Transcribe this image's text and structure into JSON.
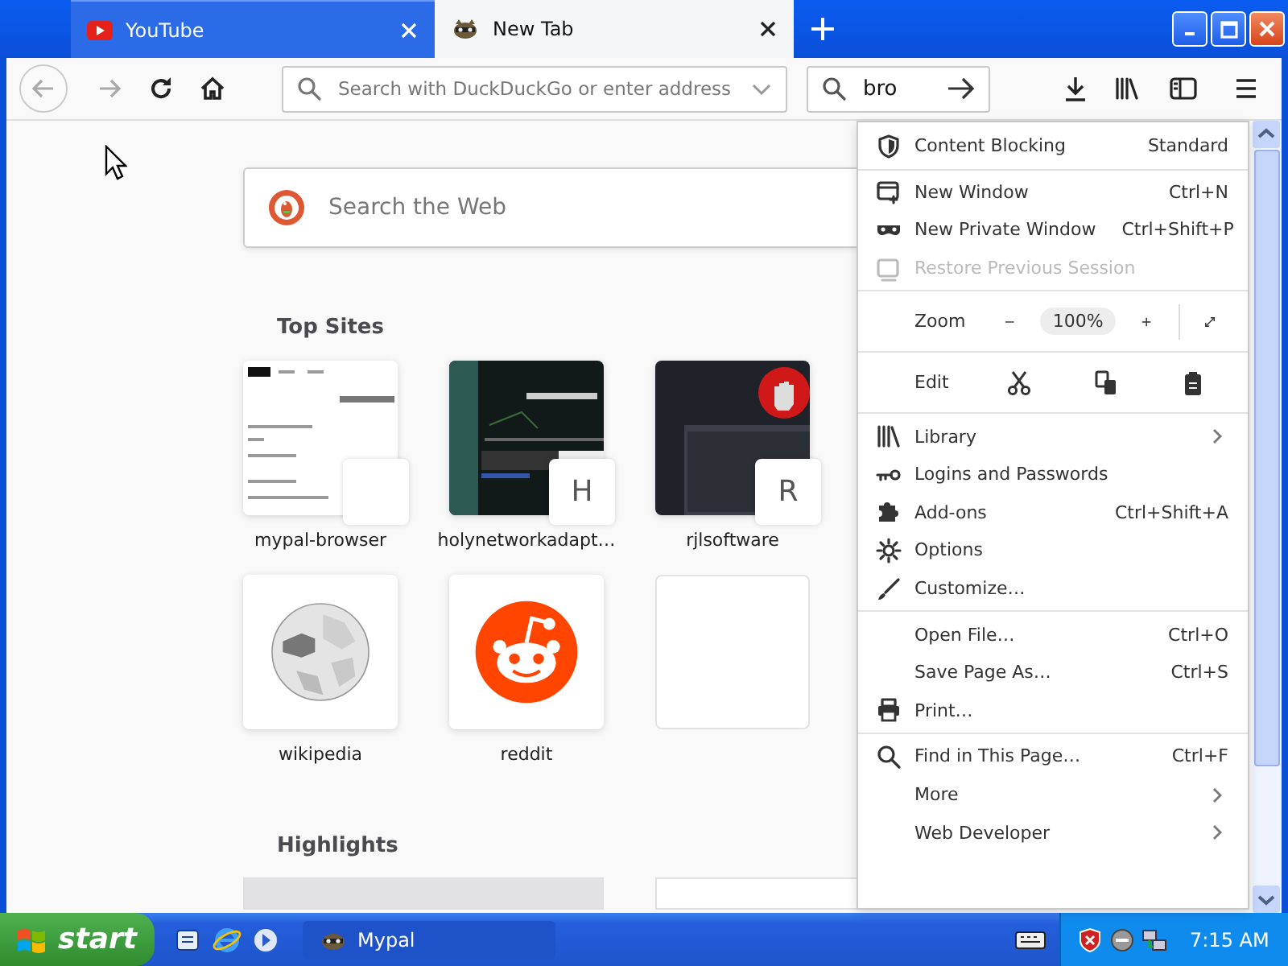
{
  "tabs": [
    {
      "label": "YouTube",
      "selected": false
    },
    {
      "label": "New Tab",
      "selected": true
    }
  ],
  "toolbar": {
    "address_placeholder": "Search with DuckDuckGo or enter address",
    "search_value": "bro"
  },
  "newtab": {
    "search_placeholder": "Search the Web",
    "top_sites_heading": "Top Sites",
    "top_sites": [
      {
        "label": "mypal-browser",
        "kind": "thumbnail"
      },
      {
        "label": "holynetworkadapt…",
        "kind": "thumbnail",
        "letter": "H"
      },
      {
        "label": "rjlsoftware",
        "kind": "thumbnail",
        "letter": "R"
      },
      {
        "label": "wikipedia",
        "kind": "logo"
      },
      {
        "label": "reddit",
        "kind": "logo"
      },
      {
        "kind": "blank"
      }
    ],
    "highlights_heading": "Highlights"
  },
  "menu": [
    {
      "kind": "item",
      "label": "Content Blocking",
      "shortcut": "Standard",
      "disabled": false
    },
    {
      "kind": "separator"
    },
    {
      "kind": "item",
      "label": "New Window",
      "shortcut": "Ctrl+N",
      "disabled": false
    },
    {
      "kind": "item",
      "label": "New Private Window",
      "shortcut": "Ctrl+Shift+P",
      "disabled": false
    },
    {
      "kind": "item",
      "label": "Restore Previous Session",
      "disabled": true
    },
    {
      "kind": "separator"
    },
    {
      "kind": "zoom",
      "label": "Zoom",
      "value": "100%"
    },
    {
      "kind": "separator"
    },
    {
      "kind": "edit",
      "label": "Edit"
    },
    {
      "kind": "separator"
    },
    {
      "kind": "item",
      "label": "Library",
      "submenu": true,
      "disabled": false
    },
    {
      "kind": "item",
      "label": "Logins and Passwords",
      "disabled": false
    },
    {
      "kind": "item",
      "label": "Add-ons",
      "shortcut": "Ctrl+Shift+A",
      "disabled": false
    },
    {
      "kind": "item",
      "label": "Options",
      "disabled": false
    },
    {
      "kind": "item",
      "label": "Customize…",
      "disabled": false
    },
    {
      "kind": "separator"
    },
    {
      "kind": "item",
      "label": "Open File…",
      "shortcut": "Ctrl+O",
      "disabled": false
    },
    {
      "kind": "item",
      "label": "Save Page As…",
      "shortcut": "Ctrl+S",
      "disabled": false
    },
    {
      "kind": "item",
      "label": "Print…",
      "disabled": false
    },
    {
      "kind": "separator"
    },
    {
      "kind": "item",
      "label": "Find in This Page…",
      "shortcut": "Ctrl+F",
      "disabled": false
    },
    {
      "kind": "item",
      "label": "More",
      "submenu": true,
      "disabled": false
    },
    {
      "kind": "item",
      "label": "Web Developer",
      "submenu": true,
      "disabled": false
    }
  ],
  "taskbar": {
    "start": "start",
    "tasks": [
      {
        "label": "Mypal",
        "selected": false
      }
    ],
    "clock": "7:15 AM"
  }
}
